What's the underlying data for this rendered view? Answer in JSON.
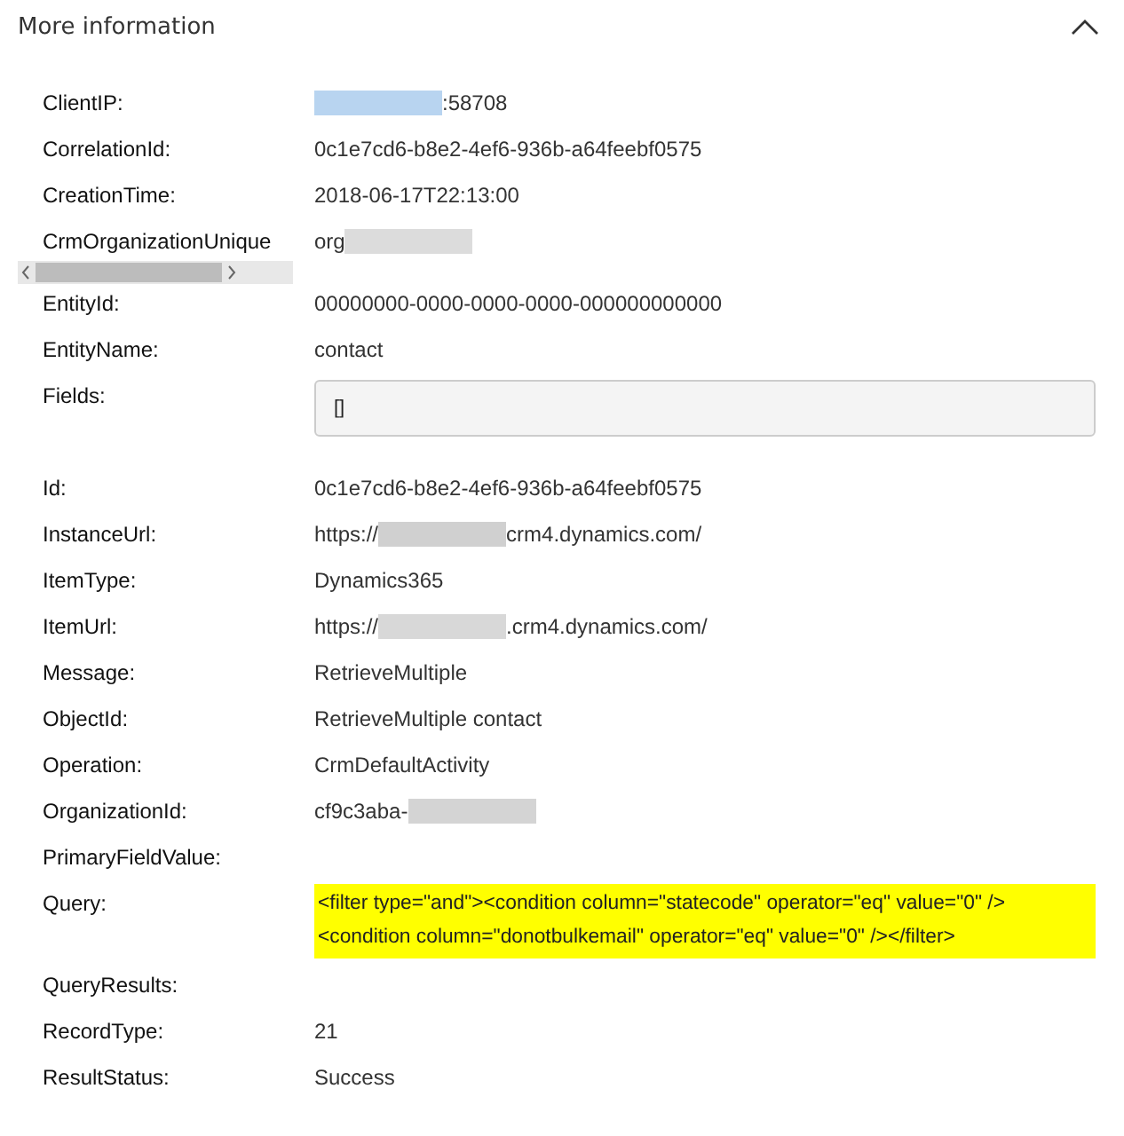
{
  "section": {
    "title": "More information",
    "expanded": true
  },
  "rows": [
    {
      "label": "ClientIP:",
      "kind": "text",
      "segments": [
        {
          "kind": "redacted",
          "color": "#b8d4f0"
        },
        {
          "kind": "text",
          "text": ":58708"
        }
      ]
    },
    {
      "label": "CorrelationId:",
      "kind": "text",
      "segments": [
        {
          "kind": "text",
          "text": "0c1e7cd6-b8e2-4ef6-936b-a64feebf0575"
        }
      ]
    },
    {
      "label": "CreationTime:",
      "kind": "text",
      "segments": [
        {
          "kind": "text",
          "text": "2018-06-17T22:13:00"
        }
      ]
    },
    {
      "label": "CrmOrganizationUnique",
      "kind": "text",
      "scrollbar": true,
      "segments": [
        {
          "kind": "text",
          "text": "org"
        },
        {
          "kind": "redacted",
          "color": "#dcdcdc"
        }
      ]
    },
    {
      "label": "EntityId:",
      "kind": "text",
      "segments": [
        {
          "kind": "text",
          "text": "00000000-0000-0000-0000-000000000000"
        }
      ]
    },
    {
      "label": "EntityName:",
      "kind": "text",
      "segments": [
        {
          "kind": "text",
          "text": "contact"
        }
      ]
    },
    {
      "label": "Fields:",
      "kind": "box",
      "segments": [
        {
          "kind": "text",
          "text": "[]"
        }
      ]
    },
    {
      "label": "Id:",
      "kind": "text",
      "segments": [
        {
          "kind": "text",
          "text": "0c1e7cd6-b8e2-4ef6-936b-a64feebf0575"
        }
      ]
    },
    {
      "label": "InstanceUrl:",
      "kind": "text",
      "segments": [
        {
          "kind": "text",
          "text": "https://"
        },
        {
          "kind": "redacted",
          "color": "#d0d0d0"
        },
        {
          "kind": "text",
          "text": "crm4.dynamics.com/"
        }
      ]
    },
    {
      "label": "ItemType:",
      "kind": "text",
      "segments": [
        {
          "kind": "text",
          "text": "Dynamics365"
        }
      ]
    },
    {
      "label": "ItemUrl:",
      "kind": "text",
      "segments": [
        {
          "kind": "text",
          "text": "https://"
        },
        {
          "kind": "redacted",
          "color": "#d8d8d8"
        },
        {
          "kind": "text",
          "text": ".crm4.dynamics.com/"
        }
      ]
    },
    {
      "label": "Message:",
      "kind": "text",
      "segments": [
        {
          "kind": "text",
          "text": "RetrieveMultiple"
        }
      ]
    },
    {
      "label": "ObjectId:",
      "kind": "text",
      "segments": [
        {
          "kind": "text",
          "text": "RetrieveMultiple contact"
        }
      ]
    },
    {
      "label": "Operation:",
      "kind": "text",
      "segments": [
        {
          "kind": "text",
          "text": "CrmDefaultActivity"
        }
      ]
    },
    {
      "label": "OrganizationId:",
      "kind": "text",
      "segments": [
        {
          "kind": "text",
          "text": "cf9c3aba-"
        },
        {
          "kind": "redacted",
          "color": "#d4d4d4"
        }
      ]
    },
    {
      "label": "PrimaryFieldValue:",
      "kind": "text",
      "segments": []
    },
    {
      "label": "Query:",
      "kind": "highlight",
      "segments": [
        {
          "kind": "text",
          "text": "<filter type=\"and\"><condition column=\"statecode\" operator=\"eq\" value=\"0\" /><condition column=\"donotbulkemail\" operator=\"eq\" value=\"0\" /></filter>"
        }
      ]
    },
    {
      "label": "QueryResults:",
      "kind": "text",
      "segments": []
    },
    {
      "label": "RecordType:",
      "kind": "text",
      "segments": [
        {
          "kind": "text",
          "text": "21"
        }
      ]
    },
    {
      "label": "ResultStatus:",
      "kind": "text",
      "segments": [
        {
          "kind": "text",
          "text": "Success"
        }
      ]
    }
  ]
}
